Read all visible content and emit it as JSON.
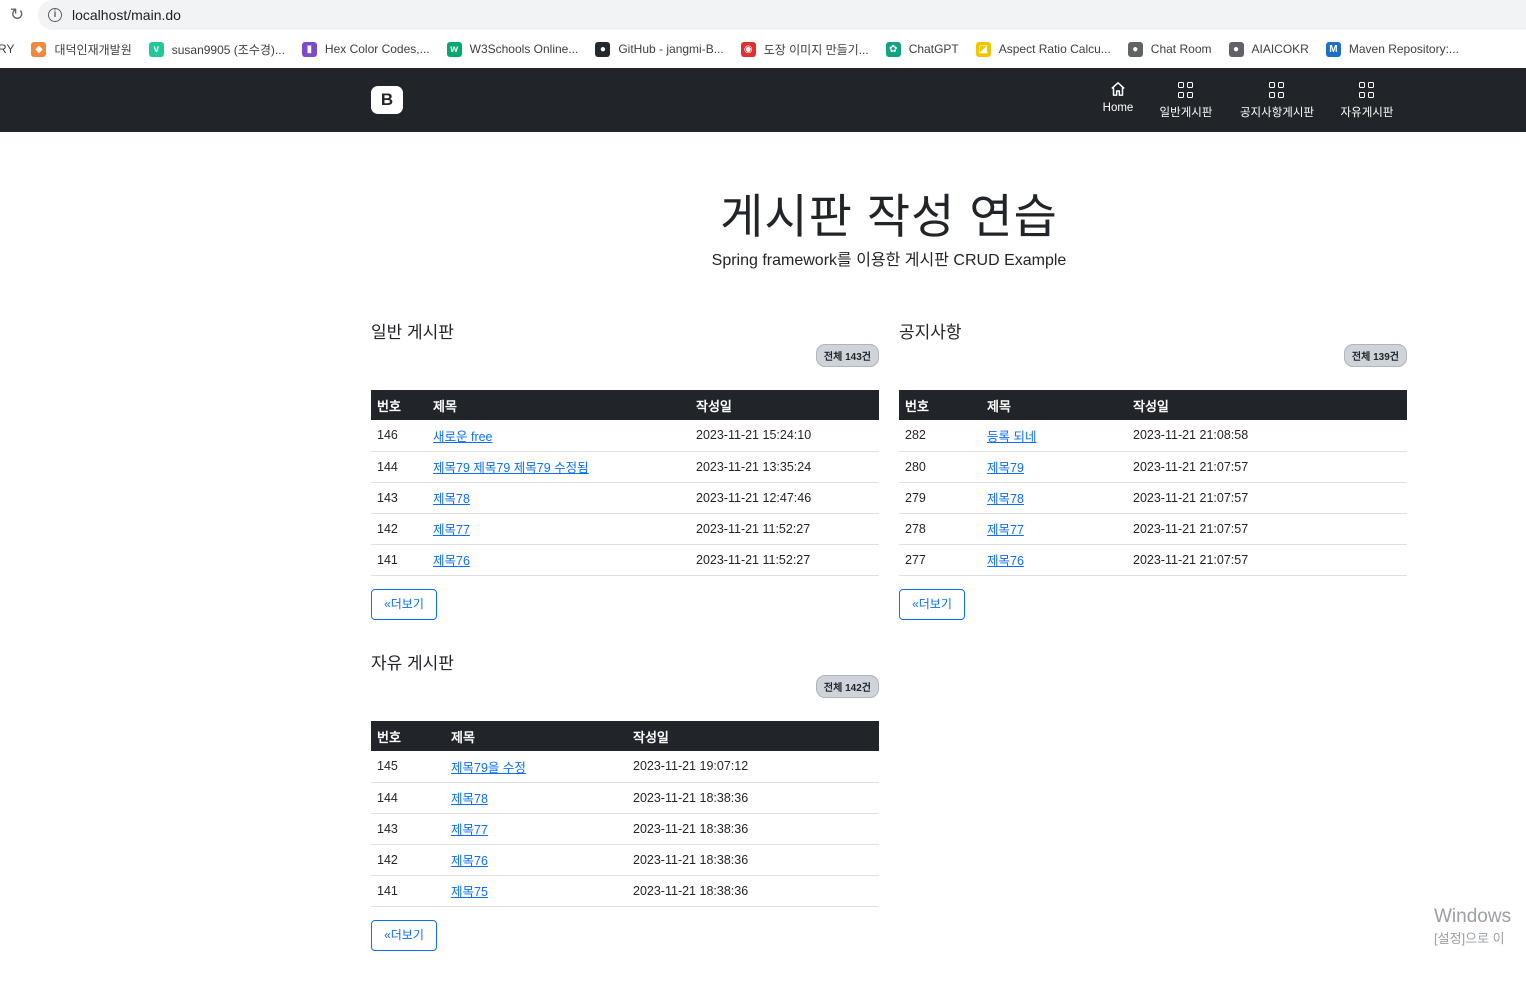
{
  "browser": {
    "url": "localhost/main.do",
    "bookmarks": [
      {
        "label": "RY",
        "icon": "partial-bookmark-icon",
        "color": "#ffffff"
      },
      {
        "label": "대덕인재개발원",
        "icon": "diamond-icon",
        "color": "#f0883e"
      },
      {
        "label": "susan9905 (조수경)...",
        "icon": "velog-icon",
        "color": "#20c997"
      },
      {
        "label": "Hex Color Codes,...",
        "icon": "colorbook-icon",
        "color": "#7b4bc9"
      },
      {
        "label": "W3Schools Online...",
        "icon": "w3schools-icon",
        "color": "#04aa6d"
      },
      {
        "label": "GitHub - jangmi-B...",
        "icon": "github-icon",
        "color": "#24292f"
      },
      {
        "label": "도장 이미지 만들기...",
        "icon": "stamp-icon",
        "color": "#e03131"
      },
      {
        "label": "ChatGPT",
        "icon": "chatgpt-icon",
        "color": "#10a37f"
      },
      {
        "label": "Aspect Ratio Calcu...",
        "icon": "aspect-ratio-icon",
        "color": "#f5c400"
      },
      {
        "label": "Chat Room",
        "icon": "globe-icon",
        "color": "#5f6368"
      },
      {
        "label": "AIAICOKR",
        "icon": "globe-icon",
        "color": "#5f6368"
      },
      {
        "label": "Maven Repository:...",
        "icon": "maven-icon",
        "color": "#1a6fc9"
      }
    ]
  },
  "navbar": {
    "brand": "B",
    "items": [
      {
        "label": "Home",
        "icon": "home-icon"
      },
      {
        "label": "일반게시판",
        "icon": "grid-icon"
      },
      {
        "label": "공지사항게시판",
        "icon": "grid-icon"
      },
      {
        "label": "자유게시판",
        "icon": "grid-icon"
      }
    ]
  },
  "hero": {
    "title": "게시판 작성 연습",
    "subtitle": "Spring framework를 이용한 게시판 CRUD Example"
  },
  "boards": {
    "general": {
      "title": "일반 게시판",
      "count": "전체 143건",
      "headers": [
        "번호",
        "제목",
        "작성일"
      ],
      "rows": [
        {
          "no": "146",
          "title": "새로운 free",
          "date": "2023-11-21 15:24:10"
        },
        {
          "no": "144",
          "title": "제목79 제목79 제목79 수정됨",
          "date": "2023-11-21 13:35:24"
        },
        {
          "no": "143",
          "title": "제목78",
          "date": "2023-11-21 12:47:46"
        },
        {
          "no": "142",
          "title": "제목77",
          "date": "2023-11-21 11:52:27"
        },
        {
          "no": "141",
          "title": "제목76",
          "date": "2023-11-21 11:52:27"
        }
      ],
      "more": "«더보기"
    },
    "notice": {
      "title": "공지사항",
      "count": "전체 139건",
      "headers": [
        "번호",
        "제목",
        "작성일"
      ],
      "rows": [
        {
          "no": "282",
          "title": "등록 되네",
          "date": "2023-11-21 21:08:58"
        },
        {
          "no": "280",
          "title": "제목79",
          "date": "2023-11-21 21:07:57"
        },
        {
          "no": "279",
          "title": "제목78",
          "date": "2023-11-21 21:07:57"
        },
        {
          "no": "278",
          "title": "제목77",
          "date": "2023-11-21 21:07:57"
        },
        {
          "no": "277",
          "title": "제목76",
          "date": "2023-11-21 21:07:57"
        }
      ],
      "more": "«더보기"
    },
    "free": {
      "title": "자유 게시판",
      "count": "전체 142건",
      "headers": [
        "번호",
        "제목",
        "작성일"
      ],
      "rows": [
        {
          "no": "145",
          "title": "제목79을 수정",
          "date": "2023-11-21 19:07:12"
        },
        {
          "no": "144",
          "title": "제목78",
          "date": "2023-11-21 18:38:36"
        },
        {
          "no": "143",
          "title": "제목77",
          "date": "2023-11-21 18:38:36"
        },
        {
          "no": "142",
          "title": "제목76",
          "date": "2023-11-21 18:38:36"
        },
        {
          "no": "141",
          "title": "제목75",
          "date": "2023-11-21 18:38:36"
        }
      ],
      "more": "«더보기"
    }
  },
  "watermark": {
    "line1": "Windows",
    "line2": "[설정]으로 이"
  }
}
